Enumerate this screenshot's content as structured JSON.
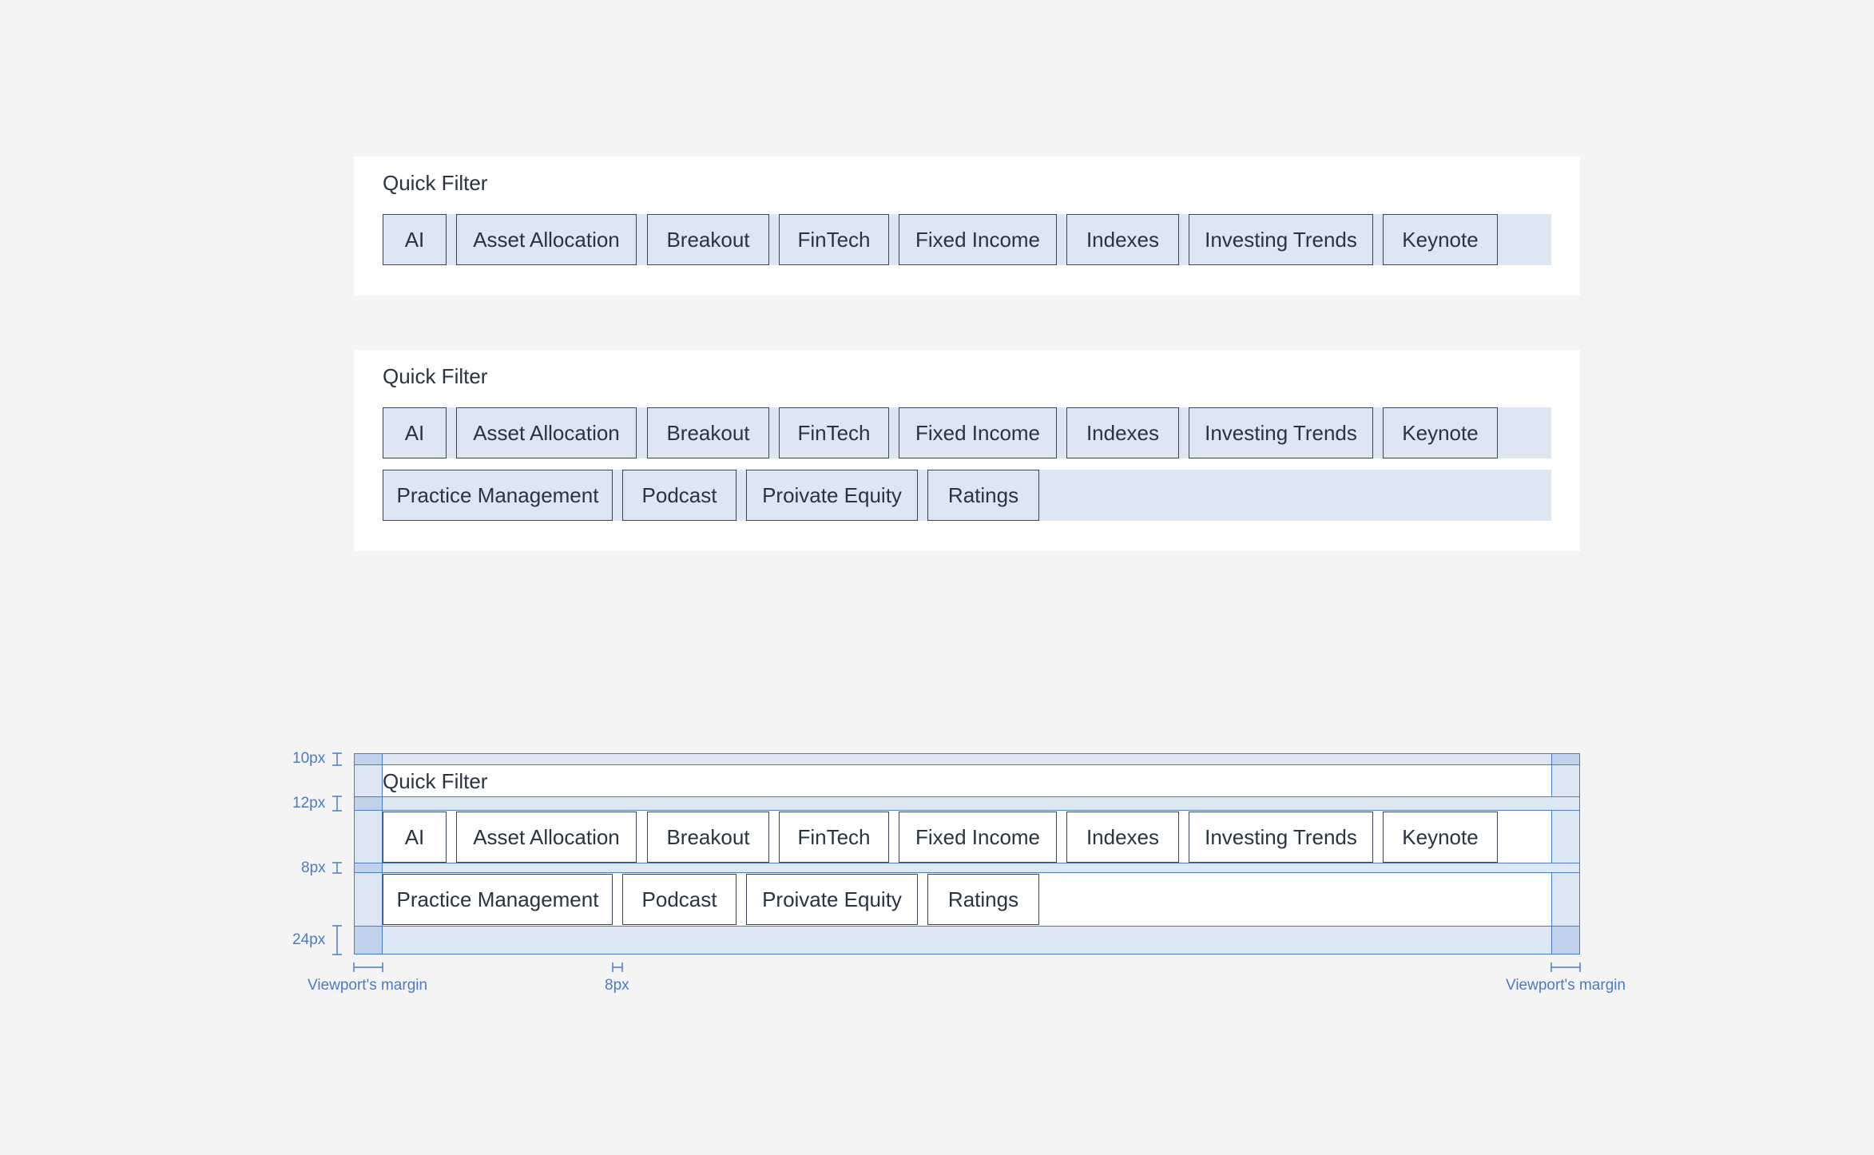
{
  "variant_single": {
    "title": "Quick Filter",
    "chips": [
      "AI",
      "Asset Allocation",
      "Breakout",
      "FinTech",
      "Fixed Income",
      "Indexes",
      "Investing Trends",
      "Keynote"
    ]
  },
  "variant_wrapped": {
    "title": "Quick Filter",
    "row1": [
      "AI",
      "Asset Allocation",
      "Breakout",
      "FinTech",
      "Fixed Income",
      "Indexes",
      "Investing Trends",
      "Keynote"
    ],
    "row2": [
      "Practice Management",
      "Podcast",
      "Proivate Equity",
      "Ratings"
    ]
  },
  "spec": {
    "title": "Quick Filter",
    "row1": [
      "AI",
      "Asset Allocation",
      "Breakout",
      "FinTech",
      "Fixed Income",
      "Indexes",
      "Investing Trends",
      "Keynote"
    ],
    "row2": [
      "Practice Management",
      "Podcast",
      "Proivate Equity",
      "Ratings"
    ],
    "labels": {
      "top_padding": "10px",
      "title_gap": "12px",
      "row_gap": "8px",
      "bottom_padding": "24px",
      "left_margin": "Viewport's margin",
      "chip_gap": "8px",
      "right_margin": "Viewport's margin"
    }
  },
  "colors": {
    "background": "#f4f4f4",
    "panel": "#ffffff",
    "chip_fill": "#dde7f3",
    "chip_border": "#3a4656",
    "annotation": "#4a7bc8",
    "overlay_dark": "#bfd1eb",
    "overlay_light": "#dde7f3"
  }
}
